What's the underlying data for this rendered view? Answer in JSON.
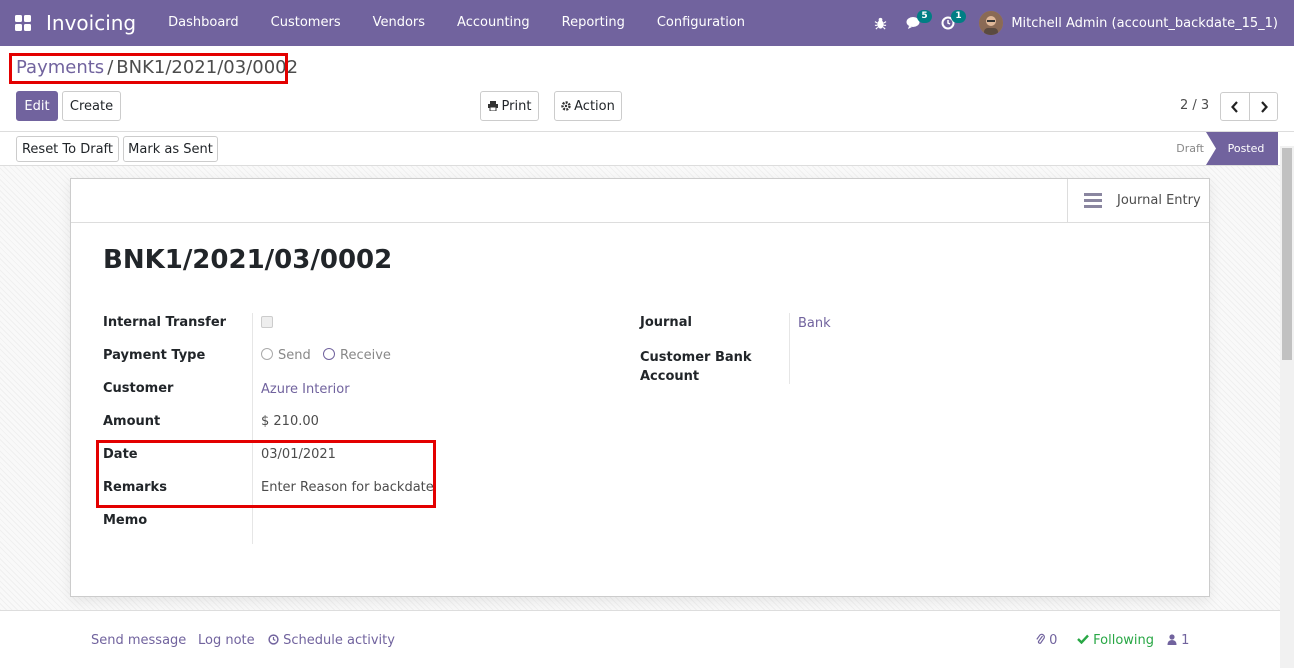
{
  "navbar": {
    "app_title": "Invoicing",
    "menu": [
      "Dashboard",
      "Customers",
      "Vendors",
      "Accounting",
      "Reporting",
      "Configuration"
    ],
    "messages_count": "5",
    "activities_count": "1",
    "user": "Mitchell Admin (account_backdate_15_1)"
  },
  "breadcrumb": {
    "parent": "Payments",
    "separator": "/",
    "current": "BNK1/2021/03/0002"
  },
  "buttons": {
    "edit": "Edit",
    "create": "Create",
    "print": "Print",
    "action": "Action",
    "reset_to_draft": "Reset To Draft",
    "mark_as_sent": "Mark as Sent"
  },
  "pager": "2 / 3",
  "status": {
    "draft": "Draft",
    "posted": "Posted"
  },
  "sheet": {
    "smart_button": "Journal Entry",
    "title": "BNK1/2021/03/0002",
    "left_fields": {
      "internal_transfer": "Internal Transfer",
      "payment_type": "Payment Type",
      "payment_type_send": "Send",
      "payment_type_receive": "Receive",
      "customer": "Customer",
      "customer_value": "Azure Interior",
      "amount": "Amount",
      "amount_value": "$ 210.00",
      "date": "Date",
      "date_value": "03/01/2021",
      "remarks": "Remarks",
      "remarks_value": "Enter Reason for backdate",
      "memo": "Memo"
    },
    "right_fields": {
      "journal": "Journal",
      "journal_value": "Bank",
      "customer_bank_account_line1": "Customer Bank",
      "customer_bank_account_line2": "Account"
    }
  },
  "chatter": {
    "send_message": "Send message",
    "log_note": "Log note",
    "schedule_activity": "Schedule activity",
    "attachments": "0",
    "following": "Following",
    "followers": "1"
  },
  "colors": {
    "brand": "#71639e",
    "highlight": "#e30000",
    "badge": "#017e84",
    "following": "#28a745"
  }
}
